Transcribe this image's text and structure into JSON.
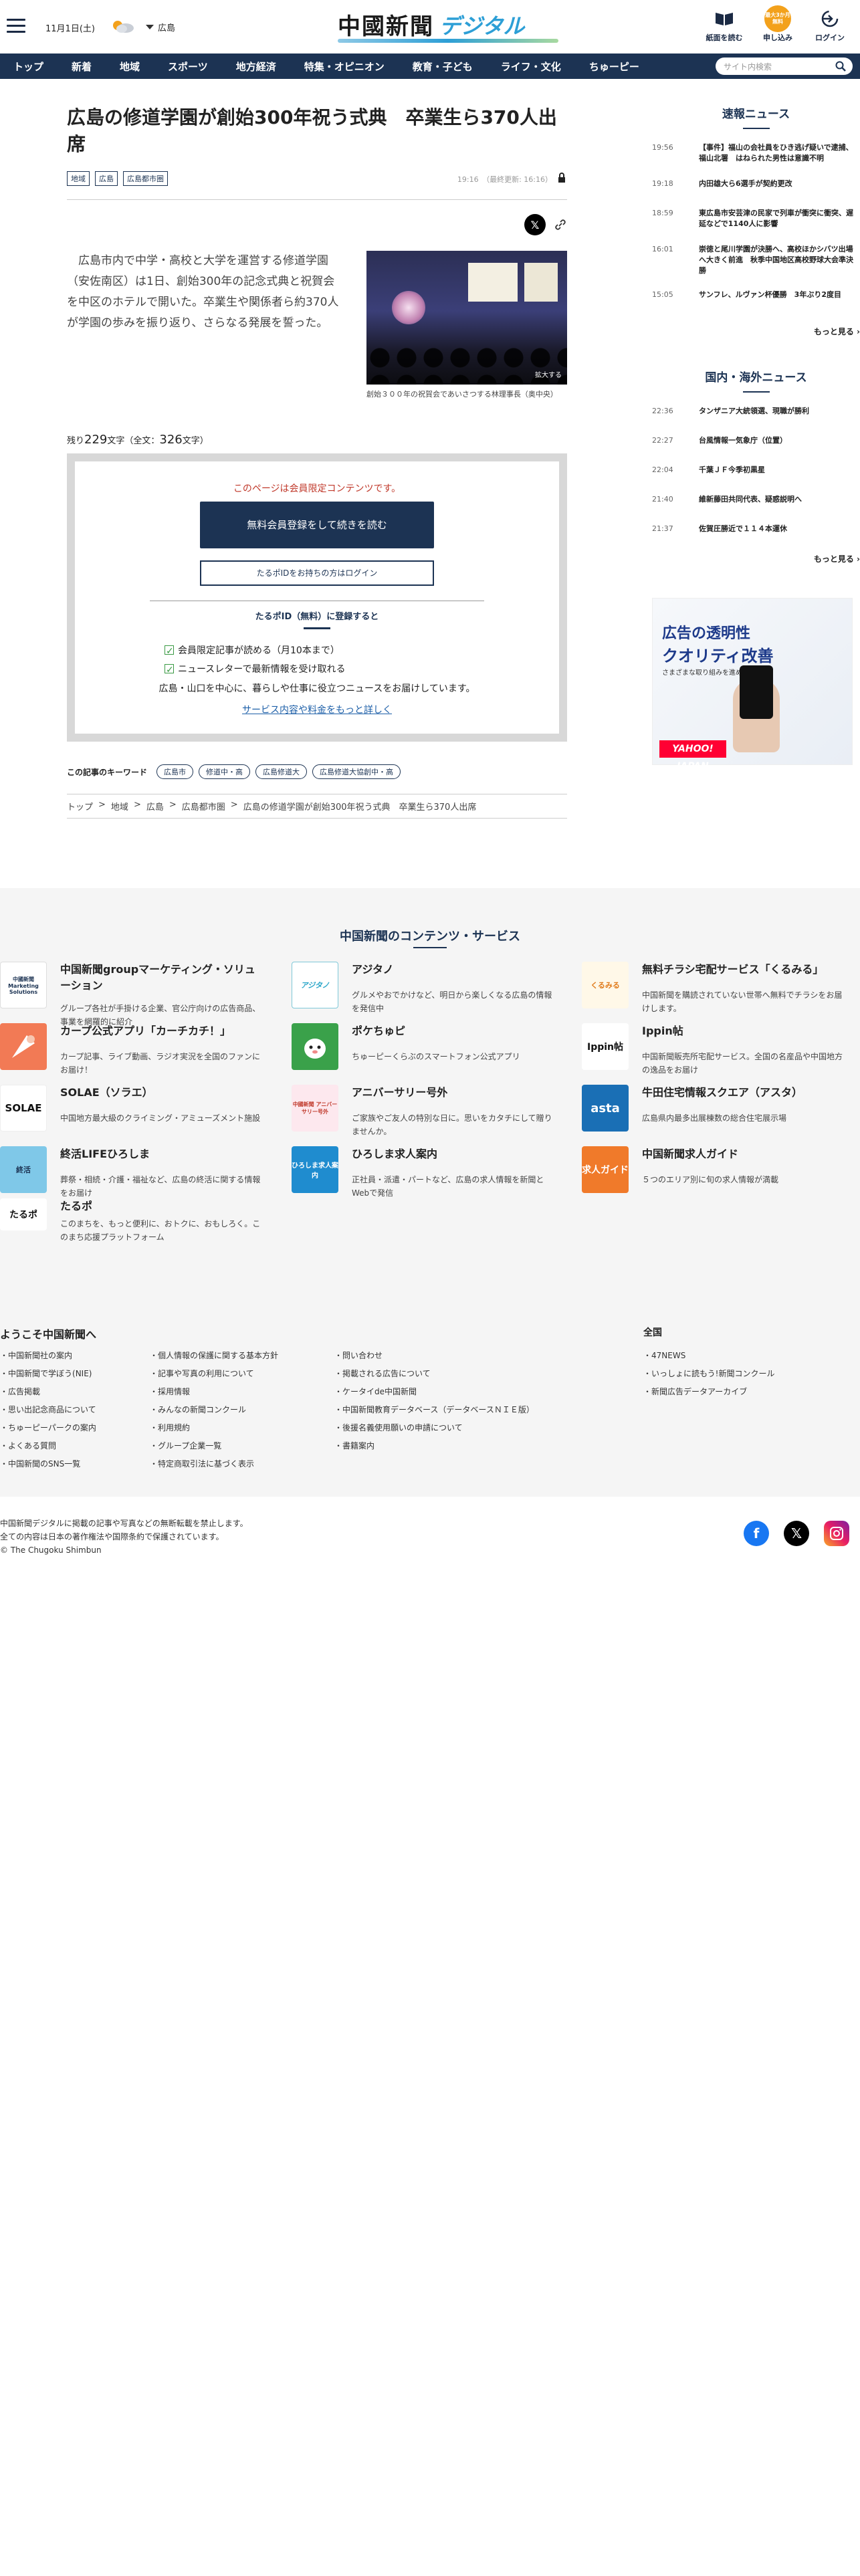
{
  "header": {
    "date": "11月1日(土)",
    "region": "広島",
    "logo_main": "中國新聞",
    "logo_sub": "デジタル",
    "btn_paper": "紙面を読む",
    "btn_apply": "申し込み",
    "btn_apply_badge": "最大3か月無料",
    "btn_login": "ログイン"
  },
  "nav": {
    "items": [
      "トップ",
      "新着",
      "地域",
      "スポーツ",
      "地方経済",
      "特集・オピニオン",
      "教育・子ども",
      "ライフ・文化",
      "ちゅーピー"
    ],
    "search_placeholder": "サイト内検索"
  },
  "article": {
    "title": "広島の修道学園が創始300年祝う式典　卒業生ら370人出席",
    "tags": [
      "地域",
      "広島",
      "広島都市圏"
    ],
    "time": "19:16　（最終更新: 16:16）",
    "lead": "　広島市内で中学・高校と大学を運営する修道学園（安佐南区）は1日、創始300年の記念式典と祝賀会を中区のホテルで開いた。卒業生や関係者ら約370人が学園の歩みを振り返り、さらなる発展を誓った。",
    "photo_enlarge": "拡大する",
    "caption": "創始３００年の祝賀会であいさつする林理事長（奥中央）",
    "remain_prefix": "残り",
    "remain_count": "229",
    "remain_mid": "文字（全文：",
    "total_count": "326",
    "remain_suffix": "文字）"
  },
  "paywall": {
    "member_only": "このページは会員限定コンテンツです。",
    "register_btn": "無料会員登録をして続きを読む",
    "login_btn": "たるポIDをお持ちの方はログイン",
    "tarupo_title": "たるポID（無料）に登録すると",
    "benefit1": "会員限定記事が読める（月10本まで）",
    "benefit2": "ニュースレターで最新情報を受け取れる",
    "note": "広島・山口を中心に、暮らしや仕事に役立つニュースをお届けしています。",
    "more": "サービス内容や料金をもっと詳しく"
  },
  "keywords": {
    "label": "この記事のキーワード",
    "items": [
      "広島市",
      "修道中・高",
      "広島修道大",
      "広島修道大協創中・高"
    ]
  },
  "breadcrumb": [
    "トップ",
    "地域",
    "広島",
    "広島都市圏",
    "広島の修道学園が創始300年祝う式典　卒業生ら370人出席"
  ],
  "breadcrumb_sep": ">",
  "sidebar": {
    "breaking_title": "速報ニュース",
    "breaking": [
      {
        "time": "19:56",
        "headline": "【事件】福山の会社員をひき逃げ疑いで逮捕、福山北署　はねられた男性は意識不明"
      },
      {
        "time": "19:18",
        "headline": "内田雄大ら6選手が契約更改"
      },
      {
        "time": "18:59",
        "headline": "東広島市安芸津の民家で列車が衝突に衝突、遅延などで1140人に影響"
      },
      {
        "time": "16:01",
        "headline": "崇徳と尾川学園が決勝へ、高校ほかシバツ出場へ大きく前進　秋季中国地区高校野球大会準決勝"
      },
      {
        "time": "15:05",
        "headline": "サンフレ、ルヴァン杯優勝　3年ぶり2度目"
      }
    ],
    "more": "もっと見る",
    "world_title": "国内・海外ニュース",
    "world": [
      {
        "time": "22:36",
        "headline": "タンザニア大統領選、現職が勝利"
      },
      {
        "time": "22:27",
        "headline": "台風情報一気象庁（位置）"
      },
      {
        "time": "22:04",
        "headline": "千葉ＪＦ今季初黒星"
      },
      {
        "time": "21:40",
        "headline": "維新藤田共同代表、疑惑説明へ"
      },
      {
        "time": "21:37",
        "headline": "佐賀圧勝近で１１４本運休"
      }
    ],
    "ad_line1": "広告の透明性",
    "ad_line2": "クオリティ改善",
    "ad_line3": "さまざまな取り組みを進めています。",
    "ad_brand": "YAHOO! JAPAN"
  },
  "contents": {
    "title": "中国新聞のコンテンツ・サービス",
    "services": [
      {
        "name": "中国新聞groupマーケティング・ソリューション",
        "desc": "グループ各社が手掛ける企業、官公庁向けの広告商品、事業を網羅的に紹介"
      },
      {
        "name": "アジタノ",
        "desc": "グルメやおでかけなど、明日から楽しくなる広島の情報を発信中"
      },
      {
        "name": "無料チラシ宅配サービス「くるみる」",
        "desc": "中国新聞を購読されていない世帯へ無料でチラシをお届けします。"
      },
      {
        "name": "カープ公式アプリ「カーチカチ！」",
        "desc": "カープ記事、ライブ動画、ラジオ実況を全国のファンにお届け！"
      },
      {
        "name": "ポケちゅピ",
        "desc": "ちゅーピーくらぶのスマートフォン公式アプリ"
      },
      {
        "name": "Ippin帖",
        "desc": "中国新聞販売所宅配サービス。全国の名産品や中国地方の逸品をお届け"
      },
      {
        "name": "SOLAE（ソラエ）",
        "desc": "中国地方最大級のクライミング・アミューズメント施設"
      },
      {
        "name": "アニバーサリー号外",
        "desc": "ご家族やご友人の特別な日に。思いをカタチにして贈りませんか。"
      },
      {
        "name": "牛田住宅情報スクエア（アスタ）",
        "desc": "広島県内最多出展棟数の総合住宅展示場"
      },
      {
        "name": "終活LIFEひろしま",
        "desc": "葬祭・相続・介護・福祉など、広島の終活に関する情報をお届け"
      },
      {
        "name": "ひろしま求人案内",
        "desc": "正社員・派遣・パートなど、広島の求人情報を新聞とWebで発信"
      },
      {
        "name": "中国新聞求人ガイド",
        "desc": "５つのエリア別に旬の求人情報が満載"
      },
      {
        "name": "たるポ",
        "desc": "このまちを、もっと便利に、おトクに、おもしろく。このまち応援プラットフォーム"
      }
    ],
    "icon_labels": {
      "mkt": "中國新聞 Marketing Solutions",
      "ajitano": "アジタノ",
      "kurumiru": "くるみる",
      "ippin": "Ippin帖",
      "solae": "SOLAE",
      "anniv": "中國新聞 アニバーサリー号外",
      "asta": "asta",
      "shukatsu": "終活",
      "kyujin_hiro": "ひろしま求人案内",
      "kyujin_guide": "求人ガイド",
      "tarupo": "たるポ"
    }
  },
  "footer_links": {
    "welcome": "ようこそ中国新聞へ",
    "col1": [
      "中国新聞社の案内",
      "中国新聞で学ぼう(NIE)",
      "広告掲載",
      "思い出記念商品について",
      "ちゅーピーパークの案内",
      "よくある質問",
      "中国新聞のSNS一覧"
    ],
    "col2": [
      "個人情報の保護に関する基本方針",
      "記事や写真の利用について",
      "採用情報",
      "みんなの新聞コンクール",
      "利用規約",
      "グループ企業一覧",
      "特定商取引法に基づく表示"
    ],
    "col3": [
      "問い合わせ",
      "掲載される広告について",
      "ケータイde中国新聞",
      "中国新聞教育データベース（データベースＮＩＥ版）",
      "後援名義使用願いの申請について",
      "書籍案内"
    ],
    "zenkoku_title": "全国",
    "col4": [
      "47NEWS",
      "いっしょに読もう!新聞コンクール",
      "新聞広告データアーカイブ"
    ]
  },
  "footer": {
    "line1": "中国新聞デジタルに掲載の記事や写真などの無断転載を禁止します。",
    "line2": "全ての内容は日本の著作権法や国際条約で保護されています。",
    "line3": "© The Chugoku Shimbun"
  },
  "colors": {
    "navy": "#1c3353",
    "accent_red": "#c0392b",
    "orange": "#f3a11b",
    "link_blue": "#1d5fa8"
  }
}
